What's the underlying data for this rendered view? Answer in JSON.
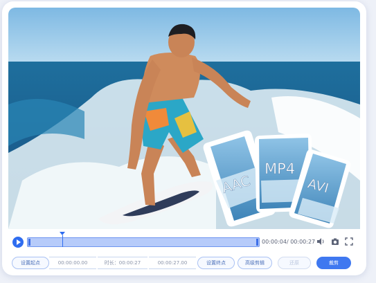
{
  "video": {
    "formats": [
      "AAC",
      "MP4",
      "AVI"
    ]
  },
  "player": {
    "current_time": "00:00:04",
    "total_time": "00:00:27",
    "time_sep": "/ ",
    "progress": 0.148
  },
  "bottom": {
    "set_start_label": "设置起点",
    "start_value": "00:00:00.00",
    "duration_label": "时长：00:00:27",
    "end_value": "00:00:27.00",
    "set_end_label": "设置终点",
    "advanced_label": "高级剪辑",
    "reset_label": "还原",
    "cut_label": "裁剪"
  },
  "colors": {
    "accent": "#3f78f0"
  }
}
